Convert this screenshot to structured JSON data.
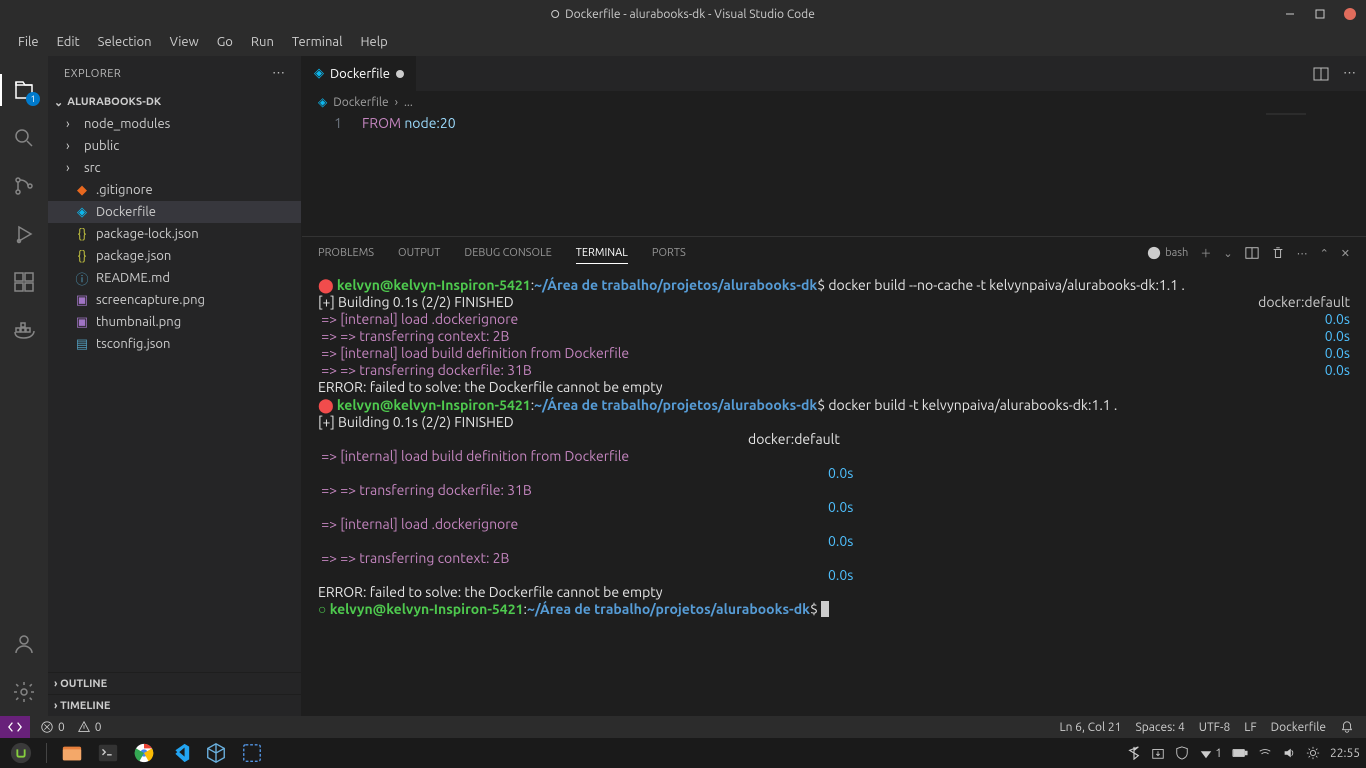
{
  "title": "Dockerfile - alurabooks-dk - Visual Studio Code",
  "menu": [
    "File",
    "Edit",
    "Selection",
    "View",
    "Go",
    "Run",
    "Terminal",
    "Help"
  ],
  "explorer": {
    "title": "EXPLORER",
    "folder": "ALURABOOKS-DK",
    "folders": [
      {
        "name": "node_modules"
      },
      {
        "name": "public"
      },
      {
        "name": "src"
      }
    ],
    "files": [
      {
        "name": ".gitignore",
        "icon": "git"
      },
      {
        "name": "Dockerfile",
        "icon": "docker",
        "selected": true
      },
      {
        "name": "package-lock.json",
        "icon": "json"
      },
      {
        "name": "package.json",
        "icon": "json"
      },
      {
        "name": "README.md",
        "icon": "md"
      },
      {
        "name": "screencapture.png",
        "icon": "img"
      },
      {
        "name": "thumbnail.png",
        "icon": "img"
      },
      {
        "name": "tsconfig.json",
        "icon": "ts"
      }
    ],
    "outline": "OUTLINE",
    "timeline": "TIMELINE"
  },
  "activitybar": {
    "badge": "1"
  },
  "tab": {
    "title": "Dockerfile"
  },
  "breadcrumb": {
    "file": "Dockerfile",
    "more": "..."
  },
  "editor": {
    "lineno": "1",
    "kw": "FROM",
    "rest": " node:20"
  },
  "panel": {
    "tabs": [
      "PROBLEMS",
      "OUTPUT",
      "DEBUG CONSOLE",
      "TERMINAL",
      "PORTS"
    ],
    "active": 3,
    "shell": "bash"
  },
  "terminal": {
    "user": "kelvyn@kelvyn-Inspiron-5421",
    "path": "~/Área de trabalho/projetos/alurabooks-dk",
    "cmd1": "docker build --no-cache -t kelvynpaiva/alurabooks-dk:1.1 .",
    "build_line": "[+] Building 0.1s (2/2) FINISHED",
    "docker_default": "docker:default",
    "l1": " => [internal] load .dockerignore",
    "l2": " => => transferring context: 2B",
    "l3": " => [internal] load build definition from Dockerfile",
    "l4": " => => transferring dockerfile: 31B",
    "time": "0.0s",
    "error": "ERROR: failed to solve: the Dockerfile cannot be empty",
    "cmd2": "docker build -t kelvynpaiva/alurabooks-dk:1.1 ."
  },
  "status": {
    "errors": "0",
    "warnings": "0",
    "lncol": "Ln 6, Col 21",
    "spaces": "Spaces: 4",
    "enc": "UTF-8",
    "eol": "LF",
    "lang": "Dockerfile"
  },
  "clock": "22:55"
}
